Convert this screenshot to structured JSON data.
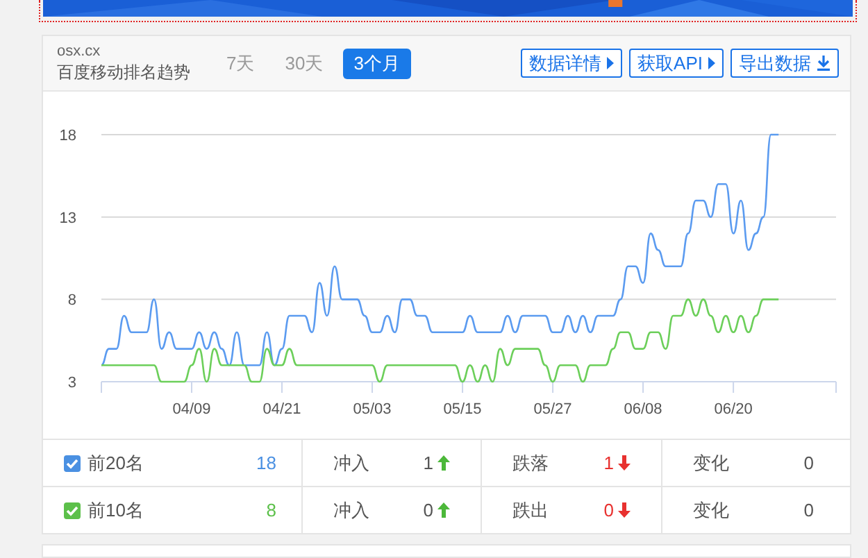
{
  "header": {
    "domain": "osx.cx",
    "subtitle": "百度移动排名趋势",
    "tabs": [
      {
        "label": "7天",
        "selected": false
      },
      {
        "label": "30天",
        "selected": false
      },
      {
        "label": "3个月",
        "selected": true
      }
    ],
    "buttons": [
      {
        "label": "数据详情",
        "kind": "caret"
      },
      {
        "label": "获取API",
        "kind": "caret"
      },
      {
        "label": "导出数据",
        "kind": "download"
      }
    ]
  },
  "chart_data": {
    "type": "line",
    "ylim": [
      3,
      18
    ],
    "yticks": [
      3,
      8,
      13,
      18
    ],
    "categories": [
      null,
      null,
      null,
      null,
      null,
      null,
      null,
      null,
      null,
      null,
      null,
      null,
      "04/09",
      null,
      null,
      null,
      null,
      null,
      null,
      null,
      null,
      null,
      null,
      null,
      "04/21",
      null,
      null,
      null,
      null,
      null,
      null,
      null,
      null,
      null,
      null,
      null,
      "05/03",
      null,
      null,
      null,
      null,
      null,
      null,
      null,
      null,
      null,
      null,
      null,
      "05/15",
      null,
      null,
      null,
      null,
      null,
      null,
      null,
      null,
      null,
      null,
      null,
      "05/27",
      null,
      null,
      null,
      null,
      null,
      null,
      null,
      null,
      null,
      null,
      null,
      "06/08",
      null,
      null,
      null,
      null,
      null,
      null,
      null,
      null,
      null,
      null,
      null,
      "06/20",
      null,
      null,
      null,
      null,
      null,
      null
    ],
    "series": [
      {
        "color": "#5b9bf0",
        "values": [
          4,
          5,
          5,
          7,
          6,
          6,
          6,
          8,
          5,
          6,
          5,
          5,
          5,
          6,
          5,
          6,
          5,
          4,
          6,
          4,
          4,
          4,
          6,
          4,
          5,
          7,
          7,
          7,
          6,
          9,
          7,
          10,
          8,
          8,
          8,
          7,
          6,
          6,
          7,
          6,
          8,
          8,
          7,
          7,
          6,
          6,
          6,
          6,
          6,
          7,
          6,
          6,
          6,
          6,
          7,
          6,
          7,
          7,
          7,
          7,
          6,
          6,
          7,
          6,
          7,
          6,
          7,
          7,
          7,
          8,
          10,
          10,
          9,
          12,
          11,
          10,
          10,
          10,
          12,
          14,
          14,
          13,
          15,
          15,
          12,
          14,
          11,
          12,
          13,
          18,
          18
        ]
      },
      {
        "color": "#6ccf5a",
        "values": [
          4,
          4,
          4,
          4,
          4,
          4,
          4,
          4,
          3,
          3,
          3,
          3,
          4,
          5,
          3,
          5,
          4,
          4,
          4,
          4,
          3,
          3,
          5,
          4,
          4,
          5,
          4,
          4,
          4,
          4,
          4,
          4,
          4,
          4,
          4,
          4,
          4,
          3,
          4,
          4,
          4,
          4,
          4,
          4,
          4,
          4,
          4,
          4,
          3,
          4,
          3,
          4,
          3,
          5,
          4,
          5,
          5,
          5,
          5,
          4,
          3,
          4,
          4,
          4,
          3,
          4,
          4,
          4,
          5,
          6,
          6,
          5,
          5,
          6,
          6,
          5,
          7,
          7,
          8,
          7,
          8,
          7,
          6,
          7,
          6,
          7,
          6,
          7,
          8,
          8,
          8
        ]
      }
    ]
  },
  "stats": [
    {
      "checked": true,
      "color": "#4a90e2",
      "label": "前20名",
      "count": "18",
      "in_label": "冲入",
      "in_value": "1",
      "out_label": "跌落",
      "out_value": "1",
      "change_label": "变化",
      "change_value": "0"
    },
    {
      "checked": true,
      "color": "#5cc04a",
      "label": "前10名",
      "count": "8",
      "in_label": "冲入",
      "in_value": "0",
      "out_label": "跌出",
      "out_value": "0",
      "change_label": "变化",
      "change_value": "0"
    }
  ]
}
